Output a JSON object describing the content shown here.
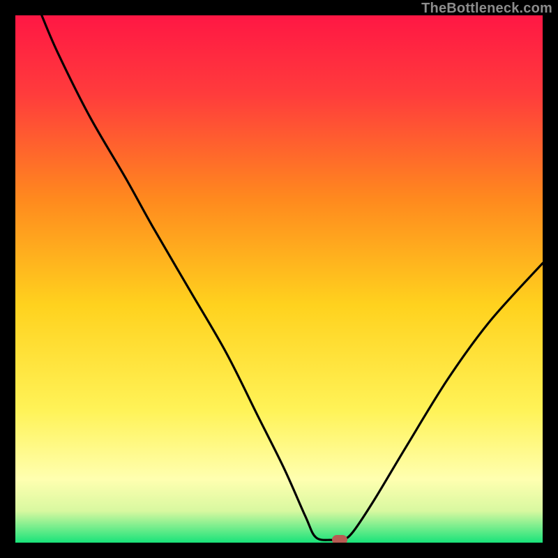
{
  "watermark": "TheBottleneck.com",
  "chart_data": {
    "type": "line",
    "title": "",
    "xlabel": "",
    "ylabel": "",
    "xlim": [
      0,
      100
    ],
    "ylim": [
      0,
      100
    ],
    "grid": false,
    "gradient_stops": [
      {
        "offset": 0.0,
        "color": "#ff1744"
      },
      {
        "offset": 0.15,
        "color": "#ff3c3c"
      },
      {
        "offset": 0.35,
        "color": "#ff8a1e"
      },
      {
        "offset": 0.55,
        "color": "#ffd21e"
      },
      {
        "offset": 0.75,
        "color": "#fff358"
      },
      {
        "offset": 0.88,
        "color": "#ffffb0"
      },
      {
        "offset": 0.94,
        "color": "#d8f8a0"
      },
      {
        "offset": 1.0,
        "color": "#19e37a"
      }
    ],
    "series": [
      {
        "name": "bottleneck-curve",
        "color": "#000000",
        "points": [
          {
            "x": 5.0,
            "y": 100.0
          },
          {
            "x": 8.0,
            "y": 93.0
          },
          {
            "x": 14.0,
            "y": 81.0
          },
          {
            "x": 21.0,
            "y": 69.0
          },
          {
            "x": 26.0,
            "y": 60.0
          },
          {
            "x": 33.0,
            "y": 48.0
          },
          {
            "x": 40.0,
            "y": 36.0
          },
          {
            "x": 46.0,
            "y": 24.0
          },
          {
            "x": 51.0,
            "y": 14.0
          },
          {
            "x": 55.0,
            "y": 5.0
          },
          {
            "x": 57.0,
            "y": 1.0
          },
          {
            "x": 60.0,
            "y": 0.5
          },
          {
            "x": 62.0,
            "y": 0.5
          },
          {
            "x": 64.0,
            "y": 2.0
          },
          {
            "x": 68.0,
            "y": 8.0
          },
          {
            "x": 74.0,
            "y": 18.0
          },
          {
            "x": 82.0,
            "y": 31.0
          },
          {
            "x": 90.0,
            "y": 42.0
          },
          {
            "x": 100.0,
            "y": 53.0
          }
        ]
      }
    ],
    "marker": {
      "x": 61.5,
      "y": 0.5,
      "color": "#b85b53"
    }
  }
}
